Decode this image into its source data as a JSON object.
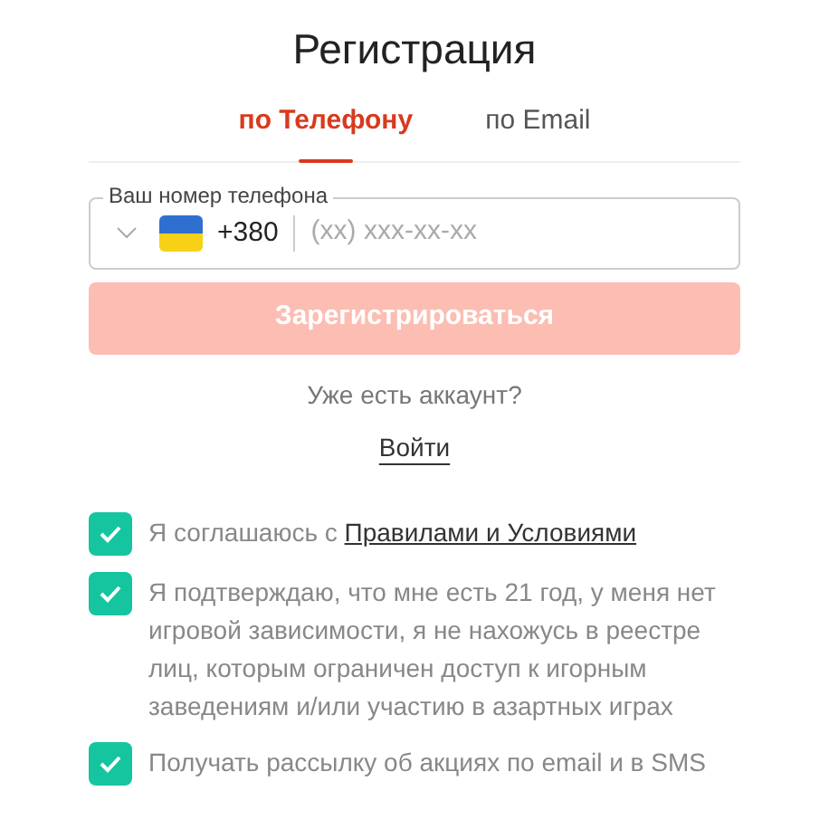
{
  "title": "Регистрация",
  "tabs": [
    {
      "label": "по Телефону",
      "selected": true
    },
    {
      "label": "по Email",
      "selected": false
    }
  ],
  "phone_field": {
    "label": "Ваш номер телефона",
    "country_code": "+380",
    "placeholder": "(xx) xxx-xx-xx"
  },
  "submit_button": {
    "label": "Зарегистрироваться",
    "disabled": true
  },
  "login_prompt": "Уже есть аккаунт?",
  "login_link": "Войти",
  "agreements": [
    {
      "text": "Я соглашаюсь с ",
      "link": "Правилами и Условиями",
      "checked": true
    },
    {
      "text": "Я подтверждаю, что мне есть 21 год, у меня нет игровой зависимости, я не нахожусь в реестре лиц, которым ограничен доступ к игорным заведениям и/или участию в азартных играх",
      "checked": true
    },
    {
      "text": "Получать рассылку об акциях по email и в SMS",
      "checked": true
    }
  ]
}
